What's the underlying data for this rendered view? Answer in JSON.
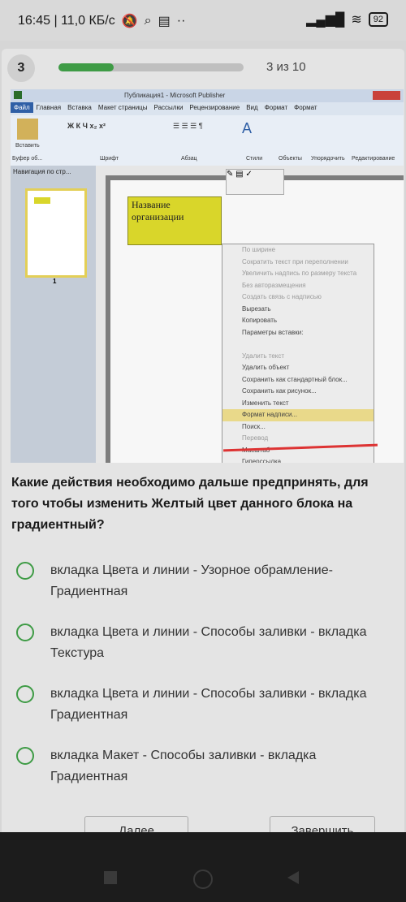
{
  "status": {
    "time_speed": "16:45 | 11,0 КБ/с",
    "battery": "92"
  },
  "quiz": {
    "number": "3",
    "progress_fraction": 0.3,
    "counter": "3 из 10",
    "question": "Какие действия необходимо дальше предпринять, для того чтобы изменить Желтый цвет данного блока на градиентный?",
    "options": [
      {
        "label": "вкладка Цвета и линии - Узорное обрамление-Градиентная"
      },
      {
        "label": "вкладка Цвета и линии - Способы заливки - вкладка Текстура"
      },
      {
        "label": "вкладка Цвета и линии - Способы заливки - вкладка Градиентная"
      },
      {
        "label": "вкладка Макет - Способы заливки - вкладка Градиентная"
      }
    ],
    "buttons": {
      "next": "Далее",
      "finish": "Завершить"
    },
    "accent_color": "#3e9b45"
  },
  "publisher": {
    "window_title": "Публикация1 - Microsoft Publisher",
    "tabs": [
      "Файл",
      "Главная",
      "Вставка",
      "Макет страницы",
      "Рассылки",
      "Рецензирование",
      "Вид",
      "Формат",
      "Формат"
    ],
    "ribbon_groups": [
      "Буфер об...",
      "Шрифт",
      "Абзац",
      "Стили",
      "Объекты",
      "Упорядочить",
      "Редактирование"
    ],
    "paste_label": "Вставить",
    "nav_header": "Навигация по стр...",
    "page_number": "1",
    "textbox_text": "Название организации",
    "context_menu": [
      {
        "label": "По ширине",
        "disabled": true
      },
      {
        "label": "Сократить текст при переполнении",
        "disabled": true
      },
      {
        "label": "Увеличить надпись по размеру текста",
        "disabled": true
      },
      {
        "label": "Без авторазмещения",
        "disabled": true
      },
      {
        "label": "Создать связь с надписью",
        "disabled": true
      },
      {
        "label": "Вырезать",
        "disabled": false
      },
      {
        "label": "Копировать",
        "disabled": false
      },
      {
        "label": "Параметры вставки:",
        "disabled": false
      },
      {
        "label": "",
        "disabled": false
      },
      {
        "label": "Удалить текст",
        "disabled": true
      },
      {
        "label": "Удалить объект",
        "disabled": false
      },
      {
        "label": "Сохранить как стандартный блок...",
        "disabled": false
      },
      {
        "label": "Сохранить как рисунок...",
        "disabled": false
      },
      {
        "label": "Изменить текст",
        "disabled": false
      },
      {
        "label": "Формат надписи...",
        "disabled": false,
        "highlight": true
      },
      {
        "label": "Поиск...",
        "disabled": false
      },
      {
        "label": "Перевод",
        "disabled": true
      },
      {
        "label": "Масштаб",
        "disabled": false
      },
      {
        "label": "Гиперссылка...",
        "disabled": false
      }
    ]
  }
}
